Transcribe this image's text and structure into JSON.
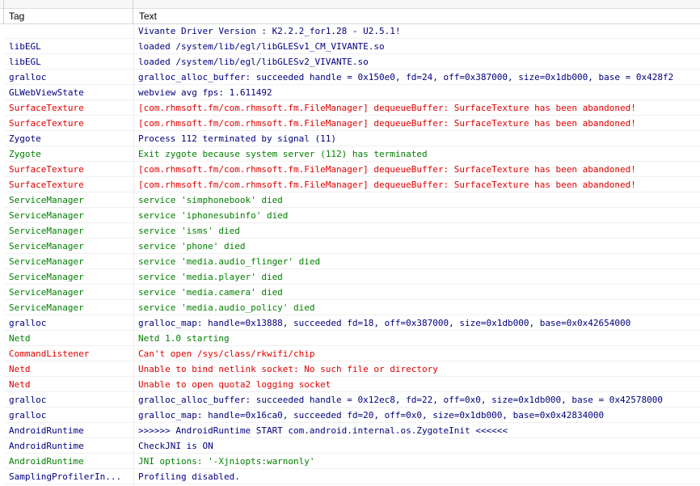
{
  "columns": {
    "tag": "Tag",
    "text": "Text"
  },
  "colors": {
    "default": "#000000",
    "error": "#e00000",
    "info": "#007f00",
    "debug": "#00007f"
  },
  "rows": [
    {
      "tag": "",
      "text": "Vivante Driver Version : K2.2.2_for1.28 - U2.5.1!",
      "level": "debug"
    },
    {
      "tag": "libEGL",
      "text": "loaded /system/lib/egl/libGLESv1_CM_VIVANTE.so",
      "level": "debug"
    },
    {
      "tag": "libEGL",
      "text": "loaded /system/lib/egl/libGLESv2_VIVANTE.so",
      "level": "debug"
    },
    {
      "tag": "gralloc",
      "text": "gralloc_alloc_buffer: succeeded handle = 0x150e0, fd=24, off=0x387000, size=0x1db000, base = 0x428f2",
      "level": "debug"
    },
    {
      "tag": "GLWebViewState",
      "text": "webview avg fps: 1.611492",
      "level": "debug"
    },
    {
      "tag": "SurfaceTexture",
      "text": "[com.rhmsoft.fm/com.rhmsoft.fm.FileManager] dequeueBuffer: SurfaceTexture has been abandoned!",
      "level": "error"
    },
    {
      "tag": "SurfaceTexture",
      "text": "[com.rhmsoft.fm/com.rhmsoft.fm.FileManager] dequeueBuffer: SurfaceTexture has been abandoned!",
      "level": "error"
    },
    {
      "tag": "Zygote",
      "text": "Process 112 terminated by signal (11)",
      "level": "debug"
    },
    {
      "tag": "Zygote",
      "text": "Exit zygote because system server (112) has terminated",
      "level": "info"
    },
    {
      "tag": "SurfaceTexture",
      "text": "[com.rhmsoft.fm/com.rhmsoft.fm.FileManager] dequeueBuffer: SurfaceTexture has been abandoned!",
      "level": "error"
    },
    {
      "tag": "SurfaceTexture",
      "text": "[com.rhmsoft.fm/com.rhmsoft.fm.FileManager] dequeueBuffer: SurfaceTexture has been abandoned!",
      "level": "error"
    },
    {
      "tag": "ServiceManager",
      "text": "service 'simphonebook' died",
      "level": "info"
    },
    {
      "tag": "ServiceManager",
      "text": "service 'iphonesubinfo' died",
      "level": "info"
    },
    {
      "tag": "ServiceManager",
      "text": "service 'isms' died",
      "level": "info"
    },
    {
      "tag": "ServiceManager",
      "text": "service 'phone' died",
      "level": "info"
    },
    {
      "tag": "ServiceManager",
      "text": "service 'media.audio_flinger' died",
      "level": "info"
    },
    {
      "tag": "ServiceManager",
      "text": "service 'media.player' died",
      "level": "info"
    },
    {
      "tag": "ServiceManager",
      "text": "service 'media.camera' died",
      "level": "info"
    },
    {
      "tag": "ServiceManager",
      "text": "service 'media.audio_policy' died",
      "level": "info"
    },
    {
      "tag": "gralloc",
      "text": "gralloc_map: handle=0x13888, succeeded fd=18, off=0x387000, size=0x1db000, base=0x0x42654000",
      "level": "debug"
    },
    {
      "tag": "Netd",
      "text": "Netd 1.0 starting",
      "level": "info"
    },
    {
      "tag": "CommandListener",
      "text": "Can't open /sys/class/rkwifi/chip",
      "level": "error"
    },
    {
      "tag": "Netd",
      "text": "Unable to bind netlink socket: No such file or directory",
      "level": "error"
    },
    {
      "tag": "Netd",
      "text": "Unable to open quota2 logging socket",
      "level": "error"
    },
    {
      "tag": "gralloc",
      "text": "gralloc_alloc_buffer: succeeded handle = 0x12ec8, fd=22, off=0x0, size=0x1db000, base = 0x42578000",
      "level": "debug"
    },
    {
      "tag": "gralloc",
      "text": "gralloc_map: handle=0x16ca0, succeeded fd=20, off=0x0, size=0x1db000, base=0x0x42834000",
      "level": "debug"
    },
    {
      "tag": "AndroidRuntime",
      "text": ">>>>>> AndroidRuntime START com.android.internal.os.ZygoteInit <<<<<<",
      "level": "debug"
    },
    {
      "tag": "AndroidRuntime",
      "text": "CheckJNI is ON",
      "level": "debug"
    },
    {
      "tag": "AndroidRuntime",
      "text": "JNI options: '-Xjniopts:warnonly'",
      "level": "info"
    },
    {
      "tag": "SamplingProfilerIn...",
      "text": "Profiling disabled.",
      "level": "debug"
    }
  ]
}
